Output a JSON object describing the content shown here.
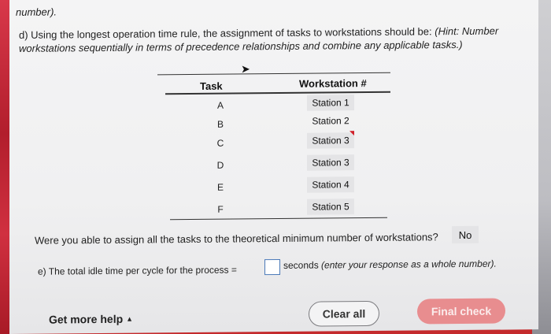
{
  "fragment": "number).",
  "question_d": {
    "prefix": "d) Using the longest operation time rule, the assignment of tasks to workstations should be: ",
    "hint": "(Hint: Number workstations sequentially in terms of precedence relationships and combine any applicable tasks.)"
  },
  "table": {
    "col_task": "Task",
    "col_station": "Workstation #",
    "rows": [
      {
        "task": "A",
        "station": "Station 1"
      },
      {
        "task": "B",
        "station": "Station 2"
      },
      {
        "task": "C",
        "station": "Station 3"
      },
      {
        "task": "D",
        "station": "Station 3"
      },
      {
        "task": "E",
        "station": "Station 4"
      },
      {
        "task": "F",
        "station": "Station 5"
      }
    ]
  },
  "question_min": {
    "text": "Were you able to assign all the tasks to the theoretical minimum number of workstations?",
    "answer": "No"
  },
  "question_e": {
    "text": "e) The total idle time per cycle for the process =",
    "suffix": "seconds",
    "instruction": "(enter your response as a whole number)."
  },
  "footer": {
    "help_label": "Get more help",
    "clear_label": "Clear all",
    "final_label": "Final check"
  },
  "colors": {
    "accent": "#e88d8f",
    "input_border": "#4a79b8",
    "marker": "#d0202a"
  }
}
